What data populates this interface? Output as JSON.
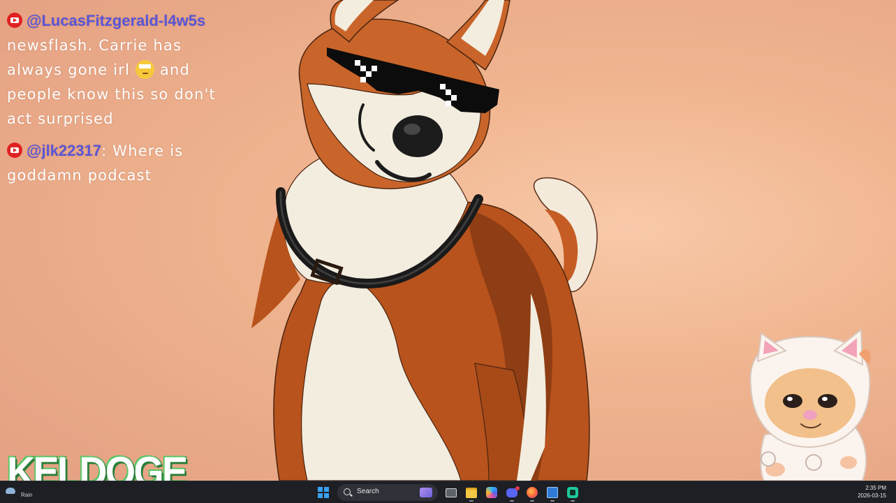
{
  "chat": {
    "messages": [
      {
        "platform_icon": "youtube-icon",
        "username": "@LucasFitzgerald-l4w5s",
        "text_before_emoji": "newsflash. Carrie has always gone irl ",
        "emoji": "face-with-rolling-eyes",
        "text_after_emoji": " and people know this so don't act surprised"
      },
      {
        "platform_icon": "youtube-icon",
        "username": "@jlk22317",
        "separator": ": ",
        "text": "Where is goddamn podcast"
      }
    ]
  },
  "overlay": {
    "logo_text": "KELDOGE"
  },
  "taskbar": {
    "weather_label": "Rain",
    "search_placeholder": "Search",
    "clock_time": "2:35 PM",
    "clock_date": "2026-03-15",
    "icons": [
      "windows-start-icon",
      "search-icon",
      "task-view-icon",
      "file-explorer-icon",
      "copilot-icon",
      "discord-icon",
      "firefox-icon",
      "app-window-icon",
      "green-app-icon"
    ]
  },
  "colors": {
    "username": "#5a56d8",
    "youtube_red": "#e02222",
    "logo_green": "#3ca24a",
    "taskbar_bg": "#1d1f24",
    "background": "#f0b690"
  }
}
